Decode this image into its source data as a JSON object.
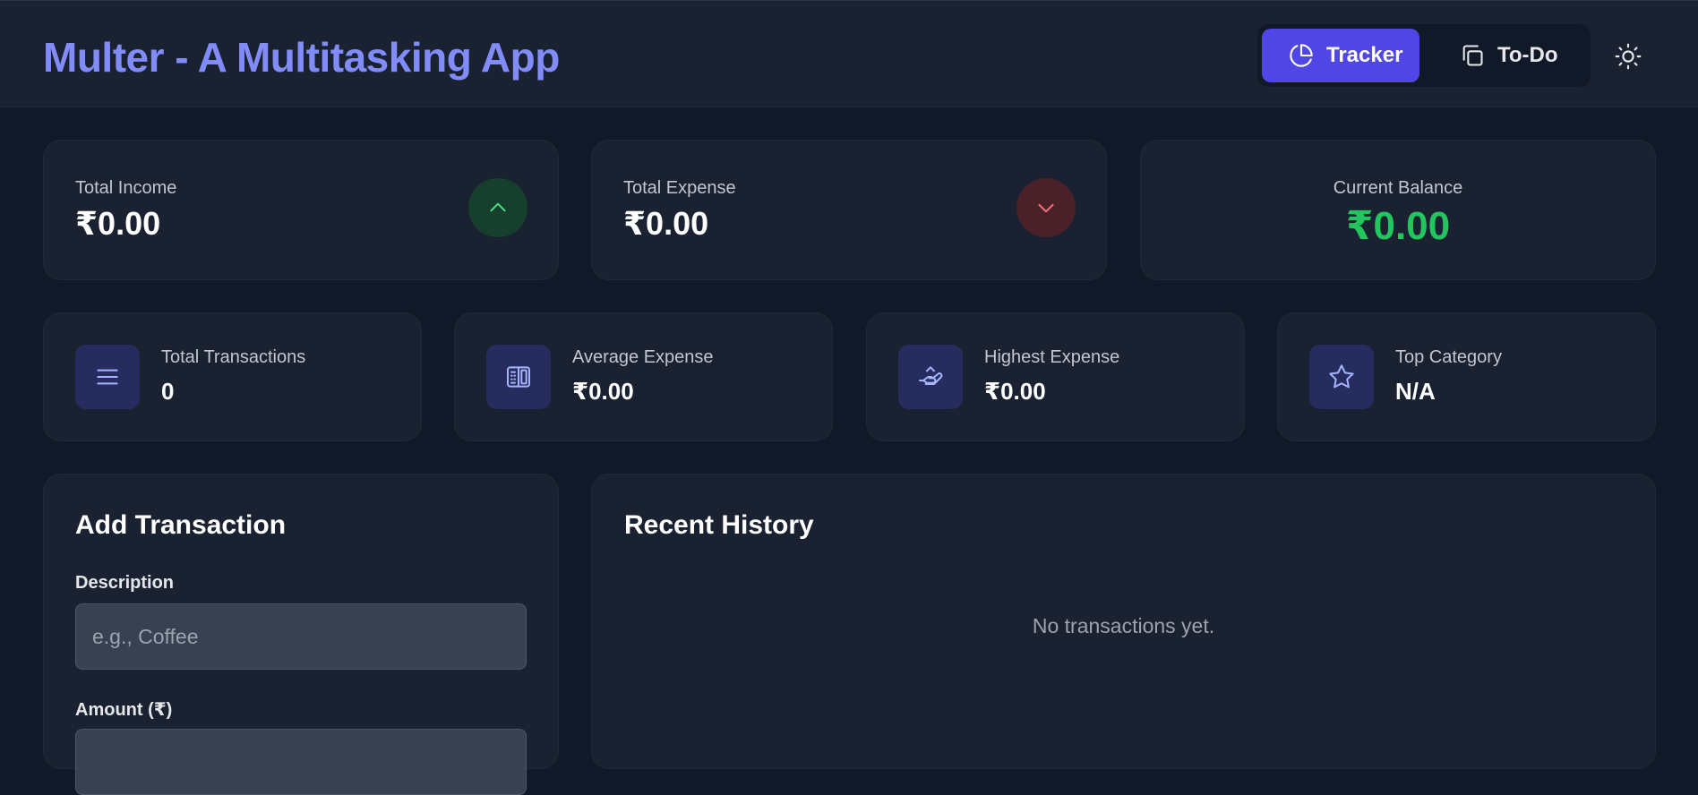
{
  "header": {
    "title": "Multer - A Multitasking App",
    "nav": [
      {
        "label": "Tracker",
        "active": true,
        "icon": "pie-chart-icon"
      },
      {
        "label": "To-Do",
        "active": false,
        "icon": "copy-icon"
      }
    ],
    "theme_icon": "sun-icon"
  },
  "summary": {
    "income": {
      "label": "Total Income",
      "value": "₹0.00",
      "icon": "chevron-up-icon",
      "color": "#4ade80"
    },
    "expense": {
      "label": "Total Expense",
      "value": "₹0.00",
      "icon": "chevron-down-icon",
      "color": "#f87171"
    },
    "balance": {
      "label": "Current Balance",
      "value": "₹0.00",
      "color": "#22c55e"
    }
  },
  "stats": [
    {
      "label": "Total Transactions",
      "value": "0",
      "icon": "list-icon"
    },
    {
      "label": "Average Expense",
      "value": "₹0.00",
      "icon": "calculator-icon"
    },
    {
      "label": "Highest Expense",
      "value": "₹0.00",
      "icon": "hand-coin-icon"
    },
    {
      "label": "Top Category",
      "value": "N/A",
      "icon": "star-icon"
    }
  ],
  "add_transaction": {
    "title": "Add Transaction",
    "description_label": "Description",
    "description_placeholder": "e.g., Coffee",
    "description_value": "",
    "amount_label": "Amount (₹)",
    "amount_placeholder": "",
    "amount_value": ""
  },
  "history": {
    "title": "Recent History",
    "empty_text": "No transactions yet."
  },
  "colors": {
    "accent": "#4f46e5",
    "title": "#818cf8",
    "background": "#111827",
    "card": "#1a2231"
  }
}
